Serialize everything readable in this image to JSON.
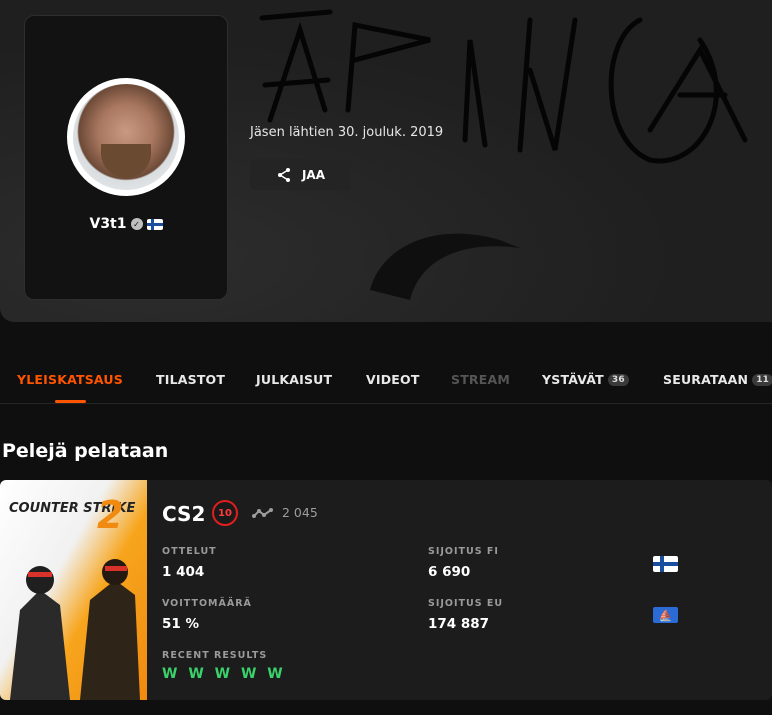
{
  "profile": {
    "username": "V3t1",
    "member_since": "Jäsen lähtien 30. jouluk. 2019",
    "share_label": "JAA",
    "icons": {
      "verified": "verified-check-icon",
      "country_flag": "finland-flag-icon",
      "share": "share-icon"
    }
  },
  "tabs": [
    {
      "label": "YLEISKATSAUS",
      "active": true
    },
    {
      "label": "TILASTOT"
    },
    {
      "label": "JULKAISUT"
    },
    {
      "label": "VIDEOT"
    },
    {
      "label": "STREAM",
      "disabled": true
    },
    {
      "label": "YSTÄVÄT",
      "count": "36"
    },
    {
      "label": "SEURATAAN",
      "count": "11"
    }
  ],
  "section": {
    "title": "Pelejä pelataan"
  },
  "game": {
    "cover_logo": "COUNTER STRIKE",
    "cover_number": "2",
    "title": "CS2",
    "level": "10",
    "elo": "2 045",
    "stats": {
      "matches_label": "OTTELUT",
      "matches_value": "1 404",
      "winrate_label": "VOITTOMÄÄRÄ",
      "winrate_value": "51 %",
      "rank_fi_label": "SIJOITUS FI",
      "rank_fi_value": "6 690",
      "rank_eu_label": "SIJOITUS EU",
      "rank_eu_value": "174 887",
      "recent_label": "RECENT RESULTS",
      "recent_value": "W W W W W"
    }
  },
  "colors": {
    "accent": "#ff5500",
    "win": "#3ad16a",
    "level": "#e01e1e"
  }
}
